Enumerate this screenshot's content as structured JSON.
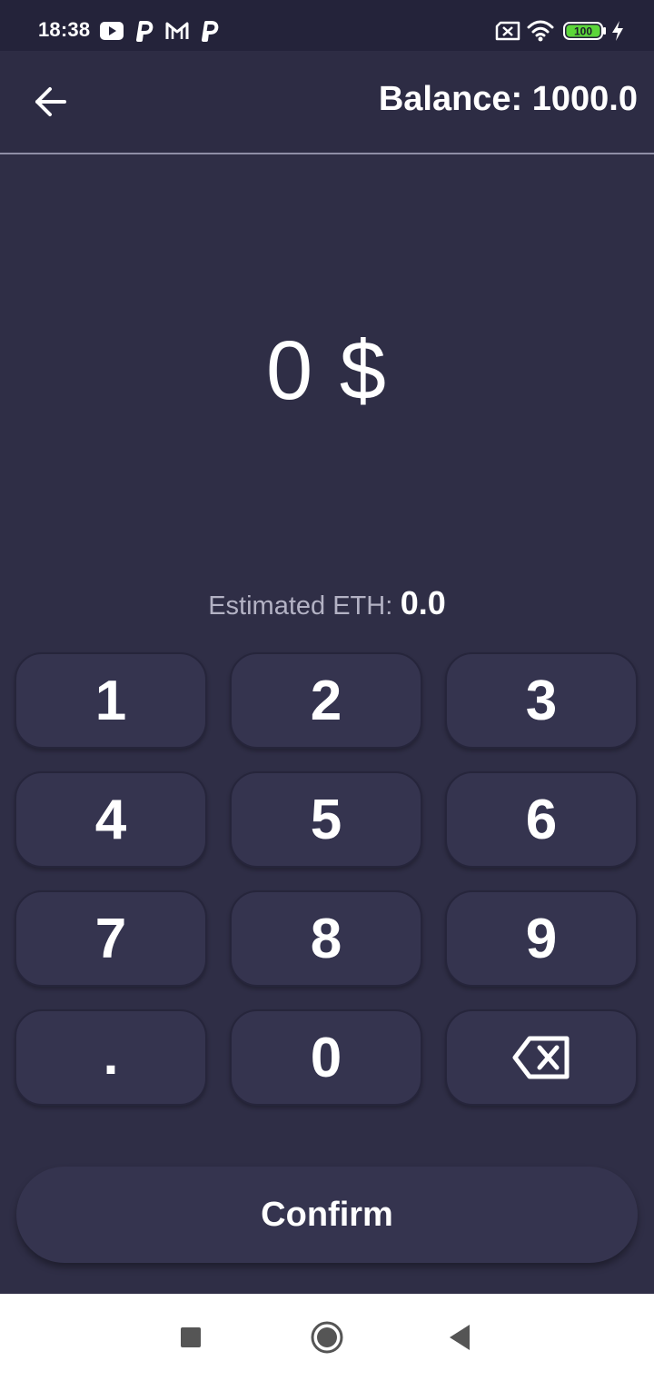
{
  "status_bar": {
    "time": "18:38",
    "notification_icons": [
      "youtube-icon",
      "p-app-icon",
      "gmail-icon",
      "p-app-icon"
    ],
    "battery_level": "100",
    "system_icons": [
      "no-sim-icon",
      "wifi-icon",
      "battery-icon",
      "charging-icon"
    ]
  },
  "app_bar": {
    "back_icon": "arrow-left-icon",
    "balance": "Balance: 1000.0"
  },
  "amount": {
    "display": "0 $"
  },
  "estimate": {
    "label": "Estimated ETH:",
    "value": "0.0"
  },
  "keypad": {
    "keys": [
      "1",
      "2",
      "3",
      "4",
      "5",
      "6",
      "7",
      "8",
      "9",
      ".",
      "0"
    ],
    "backspace_icon": "backspace-icon"
  },
  "confirm": {
    "label": "Confirm"
  },
  "nav_bar": {
    "icons": [
      "recents-square-icon",
      "home-circle-icon",
      "back-triangle-icon"
    ]
  },
  "colors": {
    "background": "#2f2e46",
    "key_fill": "#35344f",
    "estimate_label": "#b3b2c4",
    "battery_green": "#5cd63a",
    "nav_bar": "#ffffff"
  }
}
